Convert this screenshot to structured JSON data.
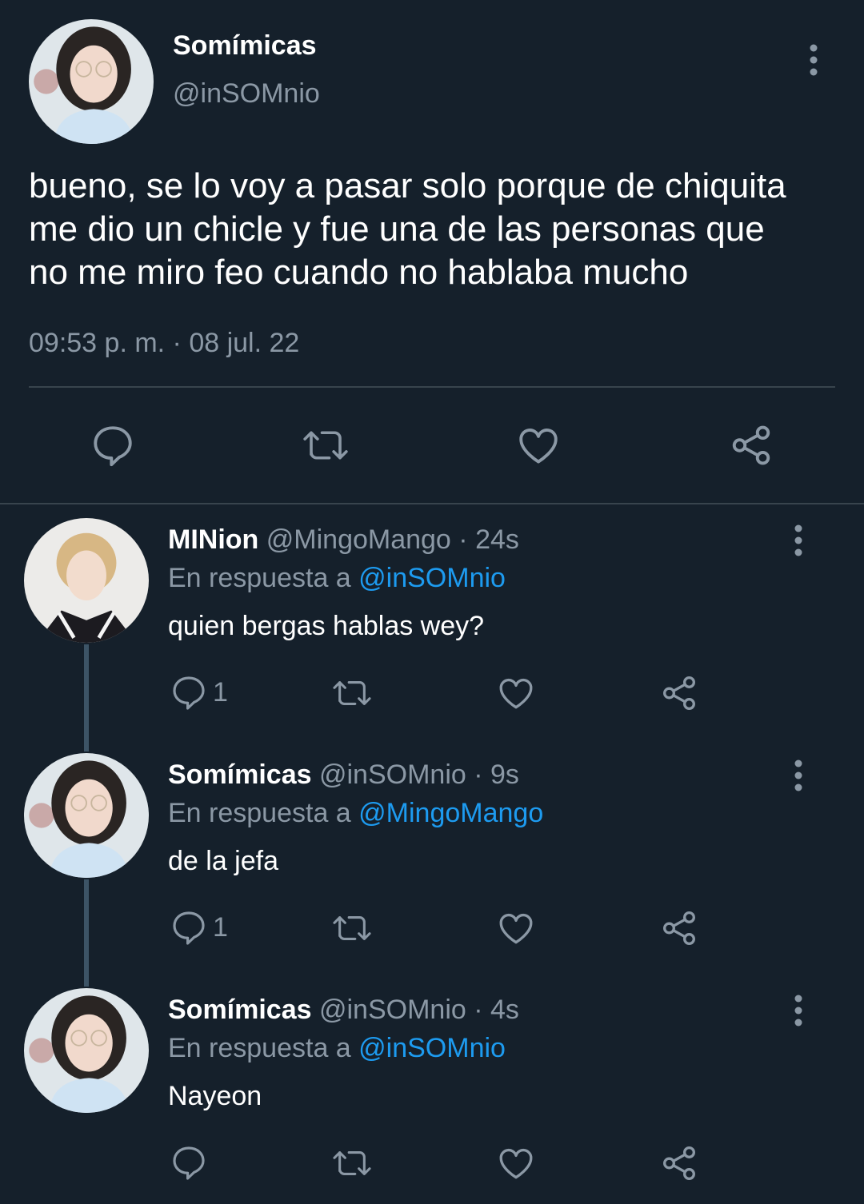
{
  "main_tweet": {
    "display_name": "Somímicas",
    "handle": "@inSOMnio",
    "text_lines": [
      "bueno, se lo voy a pasar solo porque de chiquita",
      "me dio un chicle y fue una de las personas que",
      "no me miro feo cuando no hablaba mucho"
    ],
    "timestamp": "09:53 p. m. · 08 jul. 22"
  },
  "replies": [
    {
      "display_name": "MINion",
      "handle": "@MingoMango",
      "time": "· 24s",
      "reply_prefix": "En respuesta a",
      "reply_to": "@inSOMnio",
      "text": "quien bergas hablas wey?",
      "reply_count": "1"
    },
    {
      "display_name": "Somímicas",
      "handle": "@inSOMnio",
      "time": "· 9s",
      "reply_prefix": "En respuesta a",
      "reply_to": "@MingoMango",
      "text": "de la jefa",
      "reply_count": "1"
    },
    {
      "display_name": "Somímicas",
      "handle": "@inSOMnio",
      "time": "· 4s",
      "reply_prefix": "En respuesta a",
      "reply_to": "@inSOMnio",
      "text": "Nayeon",
      "reply_count": ""
    }
  ],
  "icons": [
    "comment-icon",
    "retweet-icon",
    "like-icon",
    "share-icon",
    "more-options-icon"
  ],
  "colors": {
    "background": "#15202b",
    "text": "#ffffff",
    "muted": "#8b98a5",
    "link": "#1d9bf0",
    "divider": "#38444d"
  }
}
